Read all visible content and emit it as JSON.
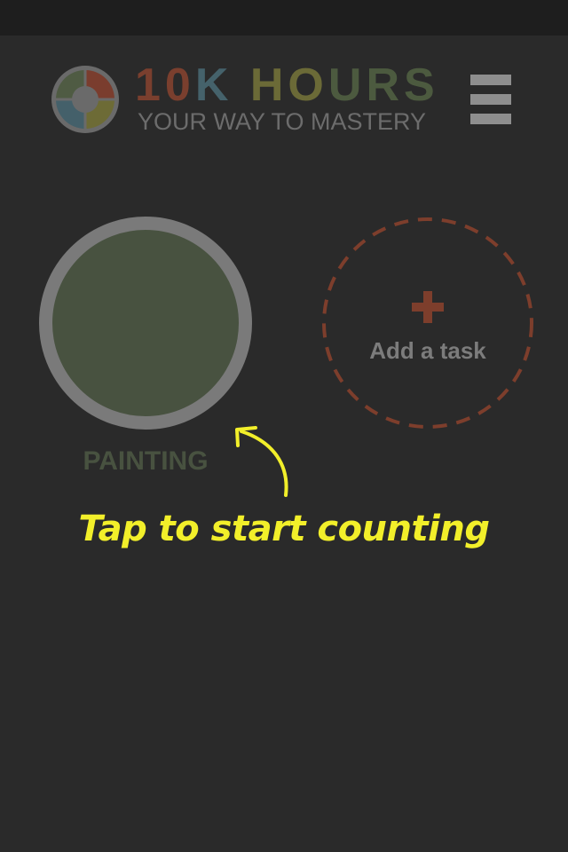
{
  "header": {
    "title_part1": "10K",
    "title_part2": "HOURS",
    "subtitle": "YOUR WAY TO MASTERY",
    "logo_icon": "quadrant-wheel-icon",
    "menu_icon": "hamburger-menu-icon"
  },
  "tasks": [
    {
      "label": "PAINTING",
      "color": "#485240"
    }
  ],
  "add_task": {
    "icon": "plus-icon",
    "label": "Add a task"
  },
  "hint": {
    "text": "Tap to start counting",
    "icon": "curved-arrow-up-icon"
  },
  "colors": {
    "background": "#2a2a2a",
    "status_bar": "#1e1e1e",
    "title_red": "#7a3f2e",
    "title_blue": "#45626b",
    "title_olive": "#6b6a37",
    "title_green": "#4c5a3f",
    "accent_red": "#7d3e2c",
    "hint_yellow": "#f2ef2a",
    "ring_gray": "#7a7a7a"
  }
}
